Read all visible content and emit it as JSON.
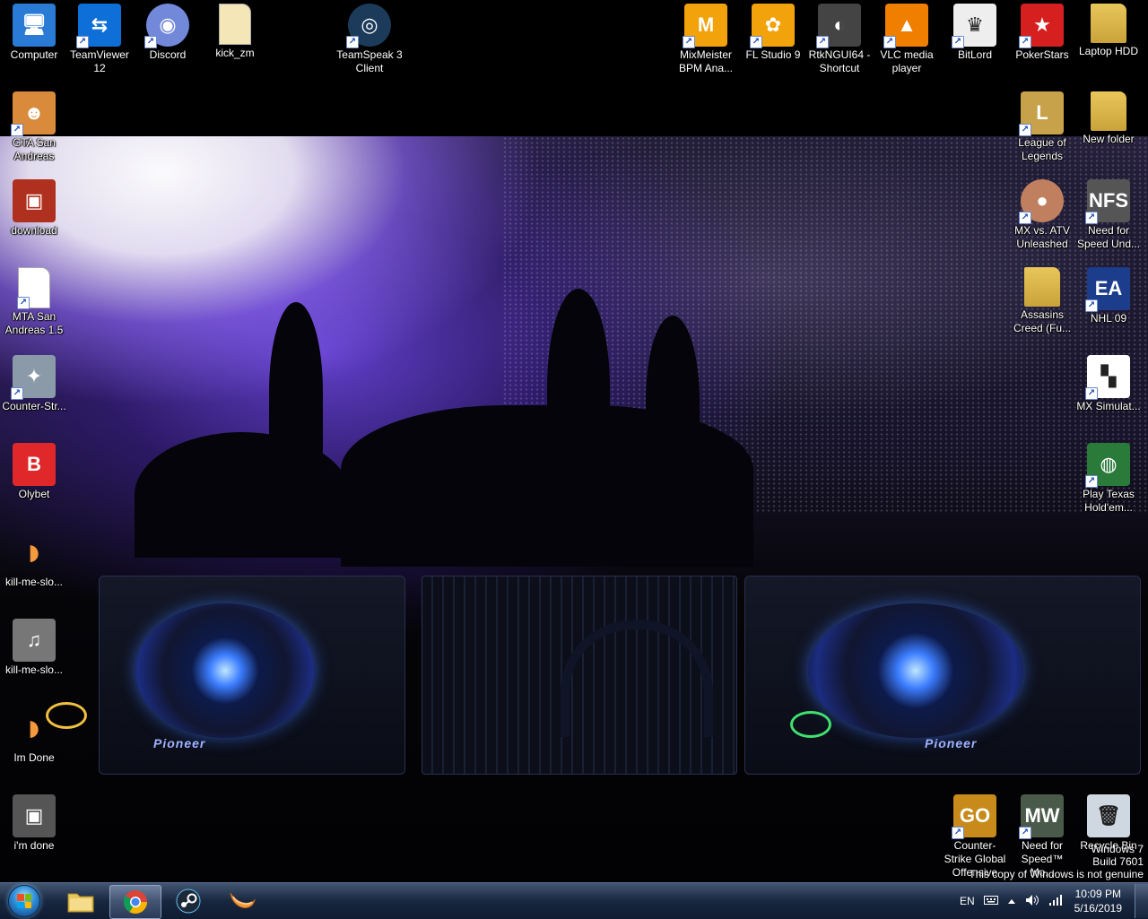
{
  "desktop": {
    "icons": [
      {
        "id": "computer",
        "label": "Computer",
        "icon": "computer-icon",
        "color": "#2a7bd6",
        "shortcut": false
      },
      {
        "id": "teamviewer",
        "label": "TeamViewer 12",
        "icon": "teamviewer-icon",
        "color": "#0e6fd8",
        "shortcut": true
      },
      {
        "id": "discord",
        "label": "Discord",
        "icon": "discord-icon",
        "color": "#7289da",
        "shortcut": true
      },
      {
        "id": "kick-zm",
        "label": "kick_zm",
        "icon": "document-icon",
        "color": "#f5e6b8",
        "shortcut": false
      },
      {
        "id": "teamspeak",
        "label": "TeamSpeak 3 Client",
        "icon": "teamspeak-icon",
        "color": "#1c3b5a",
        "shortcut": true
      },
      {
        "id": "mixmeister",
        "label": "MixMeister BPM Ana...",
        "icon": "mixmeister-icon",
        "color": "#f2a20b",
        "shortcut": true
      },
      {
        "id": "flstudio",
        "label": "FL Studio 9",
        "icon": "flstudio-icon",
        "color": "#f2a20b",
        "shortcut": true
      },
      {
        "id": "rtkngui",
        "label": "RtkNGUI64 - Shortcut",
        "icon": "speaker-icon",
        "color": "#444444",
        "shortcut": true
      },
      {
        "id": "vlc",
        "label": "VLC media player",
        "icon": "vlc-icon",
        "color": "#f07f00",
        "shortcut": true
      },
      {
        "id": "bitlord",
        "label": "BitLord",
        "icon": "bitlord-icon",
        "color": "#eeeeee",
        "shortcut": true
      },
      {
        "id": "pokerstars",
        "label": "PokerStars",
        "icon": "pokerstars-icon",
        "color": "#d62020",
        "shortcut": true
      },
      {
        "id": "laptop-hdd",
        "label": "Laptop  HDD",
        "icon": "folder-icon",
        "color": "#e8c65a",
        "shortcut": false
      },
      {
        "id": "gta-sa",
        "label": "GTA San Andreas",
        "icon": "gta-icon",
        "color": "#d98a3a",
        "shortcut": true
      },
      {
        "id": "league",
        "label": "League of Legends",
        "icon": "league-icon",
        "color": "#c8a24a",
        "shortcut": true
      },
      {
        "id": "new-folder",
        "label": "New folder",
        "icon": "folder-icon",
        "color": "#e8c65a",
        "shortcut": false
      },
      {
        "id": "download",
        "label": "download",
        "icon": "image-icon",
        "color": "#b03020",
        "shortcut": false
      },
      {
        "id": "mx-atv",
        "label": "MX vs. ATV Unleashed",
        "icon": "mx-atv-icon",
        "color": "#c08060",
        "shortcut": true
      },
      {
        "id": "nfs-und",
        "label": "Need for Speed Und...",
        "icon": "nfs-icon",
        "color": "#555555",
        "shortcut": true
      },
      {
        "id": "mta-sa",
        "label": "MTA San Andreas 1.5",
        "icon": "document-icon",
        "color": "#ffffff",
        "shortcut": true
      },
      {
        "id": "assasins",
        "label": "Assasins Creed (Fu...",
        "icon": "folder-icon",
        "color": "#e8c65a",
        "shortcut": false
      },
      {
        "id": "nhl09",
        "label": "NHL 09",
        "icon": "nhl-icon",
        "color": "#1c3c8c",
        "shortcut": true
      },
      {
        "id": "counter-strike",
        "label": "Counter-Str...",
        "icon": "counter-strike-icon",
        "color": "#8a9aa8",
        "shortcut": true
      },
      {
        "id": "mx-simulat",
        "label": "MX Simulat...",
        "icon": "checkered-flag-icon",
        "color": "#ffffff",
        "shortcut": true
      },
      {
        "id": "olybet",
        "label": "Olybet",
        "icon": "olybet-icon",
        "color": "#e0282a",
        "shortcut": false
      },
      {
        "id": "texas-holdem",
        "label": "Play Texas Hold'em...",
        "icon": "poker-chips-icon",
        "color": "#2a7a3a",
        "shortcut": true
      },
      {
        "id": "kill-me-1",
        "label": "kill-me-slo...",
        "icon": "clementine-icon",
        "color": "#f59a3c",
        "shortcut": false
      },
      {
        "id": "kill-me-2",
        "label": "kill-me-slo...",
        "icon": "album-art-icon",
        "color": "#777777",
        "shortcut": false
      },
      {
        "id": "im-done",
        "label": "Im Done",
        "icon": "clementine-icon",
        "color": "#f59a3c",
        "shortcut": false
      },
      {
        "id": "i-m-done",
        "label": "i'm done",
        "icon": "image-icon",
        "color": "#555555",
        "shortcut": false
      },
      {
        "id": "csgo",
        "label": "Counter-Strike Global Offensive",
        "icon": "csgo-icon",
        "color": "#c88a1a",
        "shortcut": true
      },
      {
        "id": "nfs-mw",
        "label": "Need for Speed™ Mo...",
        "icon": "nfs-mw-icon",
        "color": "#4a5a4a",
        "shortcut": true
      },
      {
        "id": "recycle-bin",
        "label": "Recycle Bin",
        "icon": "recycle-bin-icon",
        "color": "#cfd8e0",
        "shortcut": false
      }
    ]
  },
  "watermark": {
    "line1": "Windows 7",
    "line2": "Build 7601",
    "line3": "This copy of Windows is not genuine"
  },
  "taskbar": {
    "start_label": "Start",
    "pinned": [
      {
        "id": "explorer",
        "icon": "folder-icon",
        "active": false
      },
      {
        "id": "chrome",
        "icon": "chrome-icon",
        "active": true
      },
      {
        "id": "steam",
        "icon": "steam-icon",
        "active": false
      },
      {
        "id": "clementine",
        "icon": "clementine-icon",
        "active": false
      }
    ],
    "tray": {
      "language": "EN",
      "keyboard_icon": "keyboard-icon",
      "arrow_icon": "up-arrow-icon",
      "volume_icon": "speaker-icon",
      "network_icon": "signal-bars-icon",
      "time": "10:09 PM",
      "date": "5/16/2019"
    }
  },
  "colors": {
    "taskbar": "#1c2c48",
    "accent": "#2e8bd6"
  }
}
